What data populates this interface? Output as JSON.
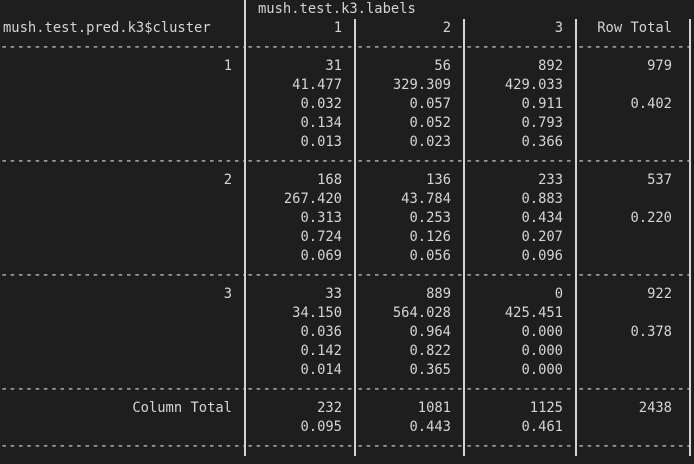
{
  "table": {
    "col_var_label": "mush.test.k3.labels",
    "row_var_label": "mush.test.pred.k3$cluster",
    "col_headers": [
      "1",
      "2",
      "3",
      "Row Total"
    ],
    "separator": "-------------------------|-----------|-----------|-----------|-----------|",
    "groups": [
      {
        "label": "1",
        "lines": [
          [
            "31",
            "56",
            "892",
            "979"
          ],
          [
            "41.477",
            "329.309",
            "429.033",
            ""
          ],
          [
            "0.032",
            "0.057",
            "0.911",
            "0.402"
          ],
          [
            "0.134",
            "0.052",
            "0.793",
            ""
          ],
          [
            "0.013",
            "0.023",
            "0.366",
            ""
          ]
        ]
      },
      {
        "label": "2",
        "lines": [
          [
            "168",
            "136",
            "233",
            "537"
          ],
          [
            "267.420",
            "43.784",
            "0.883",
            ""
          ],
          [
            "0.313",
            "0.253",
            "0.434",
            "0.220"
          ],
          [
            "0.724",
            "0.126",
            "0.207",
            ""
          ],
          [
            "0.069",
            "0.056",
            "0.096",
            ""
          ]
        ]
      },
      {
        "label": "3",
        "lines": [
          [
            "33",
            "889",
            "0",
            "922"
          ],
          [
            "34.150",
            "564.028",
            "425.451",
            ""
          ],
          [
            "0.036",
            "0.964",
            "0.000",
            "0.378"
          ],
          [
            "0.142",
            "0.822",
            "0.000",
            ""
          ],
          [
            "0.014",
            "0.365",
            "0.000",
            ""
          ]
        ]
      }
    ],
    "column_total": {
      "label": "Column Total",
      "lines": [
        [
          "232",
          "1081",
          "1125",
          "2438"
        ],
        [
          "0.095",
          "0.443",
          "0.461",
          ""
        ]
      ]
    }
  }
}
